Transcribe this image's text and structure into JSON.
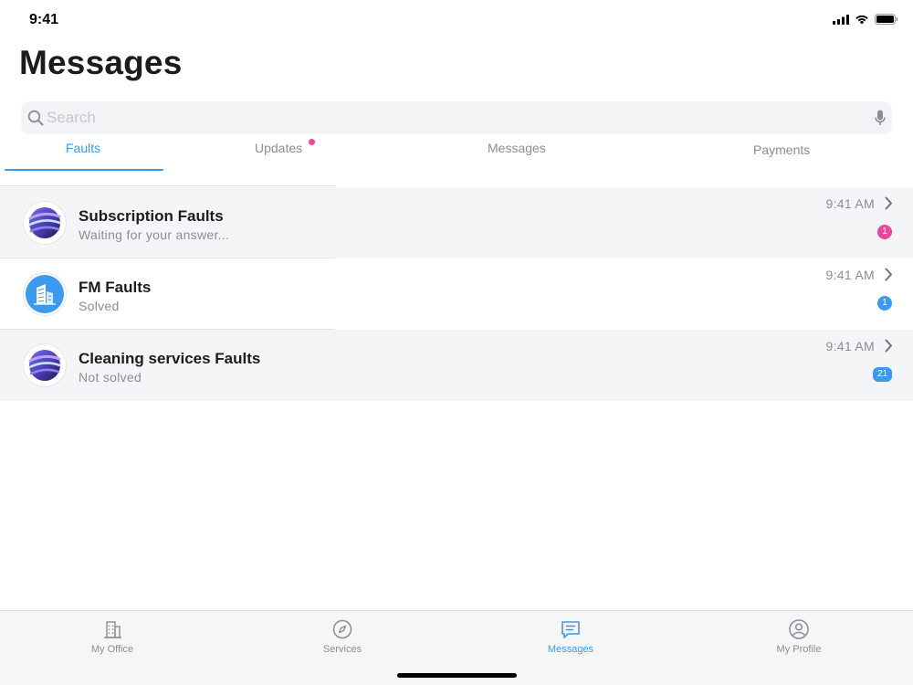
{
  "status_bar": {
    "time": "9:41",
    "icons": [
      "cellular-signal-icon",
      "wifi-icon",
      "battery-icon"
    ]
  },
  "page": {
    "title": "Messages"
  },
  "search": {
    "placeholder": "Search",
    "value": "",
    "icons": [
      "search-icon",
      "microphone-icon"
    ]
  },
  "tabs": [
    {
      "label": "Faults",
      "active": true
    },
    {
      "label": "Updates",
      "active": false,
      "has_notification_dot": true
    },
    {
      "label": "Messages",
      "active": false
    },
    {
      "label": "Payments",
      "active": false
    }
  ],
  "threads": [
    {
      "title": "Subscription Faults",
      "subtitle": "Waiting for your answer...",
      "time": "9:41 AM",
      "badge": "1",
      "badge_color": "#e8479b",
      "avatar_icon": "swirl-logo-icon"
    },
    {
      "title": "FM Faults",
      "subtitle": "Solved",
      "time": "9:41 AM",
      "badge": "1",
      "badge_color": "#3b9af0",
      "avatar_icon": "building-icon"
    },
    {
      "title": "Cleaning services Faults",
      "subtitle": "Not solved",
      "time": "9:41 AM",
      "badge": "21",
      "badge_color": "#3b9af0",
      "avatar_icon": "swirl-logo-icon"
    }
  ],
  "tab_bar": [
    {
      "label": "My Office",
      "icon": "office-building-icon",
      "active": false
    },
    {
      "label": "Services",
      "icon": "compass-icon",
      "active": false
    },
    {
      "label": "Messages",
      "icon": "chat-icon",
      "active": true
    },
    {
      "label": "My Profile",
      "icon": "profile-icon",
      "active": false
    }
  ],
  "colors": {
    "accent": "#3b9af0",
    "notification": "#e8479b",
    "title_text": "#1c1c1e",
    "secondary_text": "#8a8d93"
  }
}
